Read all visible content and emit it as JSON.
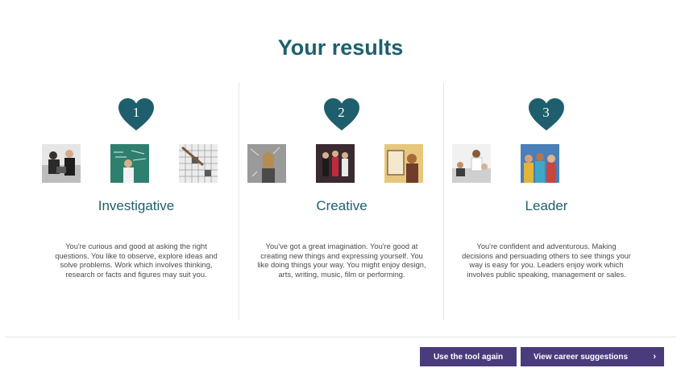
{
  "page_title": "Your results",
  "results": [
    {
      "rank": "1",
      "trait": "Investigative",
      "description": "You're curious and good at asking the right questions. You like to observe, explore ideas and solve problems. Work which involves thinking, research or facts and figures may suit you."
    },
    {
      "rank": "2",
      "trait": "Creative",
      "description": "You've got a great imagination. You're good at creating new things and expressing yourself. You like doing things your way. You might enjoy design, arts, writing, music, film or performing."
    },
    {
      "rank": "3",
      "trait": "Leader",
      "description": "You're confident and adventurous. Making decisions and persuading others to see things your way is easy for you. Leaders enjoy work which involves public speaking, management or sales."
    }
  ],
  "actions": {
    "use_again_label": "Use the tool again",
    "view_careers_label": "View career suggestions",
    "view_careers_chevron": "›"
  },
  "colors": {
    "heading": "#1f5f6d",
    "heart": "#1f5f6d",
    "button": "#4a3b7c"
  }
}
